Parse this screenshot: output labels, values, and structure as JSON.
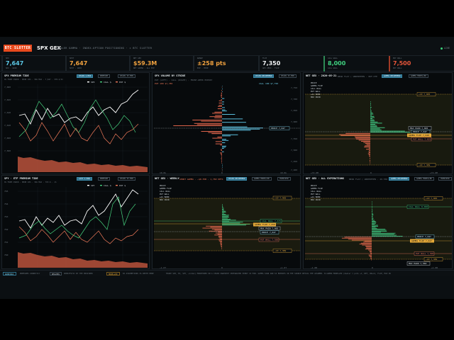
{
  "header": {
    "logo": "BTC SLOTTER",
    "brand": "SPX GEX",
    "subtitle": "DEALER GAMMA · INDEX-OPTION POSITIONING · × BTC SLOTTER",
    "live": "LIVE",
    "live_color": "#39d07a",
    "accent": "#e8491d"
  },
  "stats": [
    {
      "label": "SPX",
      "value": "7,647",
      "caption": "SPX · GRID",
      "color": "#5cc8e6"
    },
    {
      "label": "SPOT",
      "value": "7,647",
      "caption": "SPOT · GRID",
      "color": "#f3a33f"
    },
    {
      "label": "NET GEX",
      "value": "$59.3M",
      "caption": "NET GAMMA · ALL EXP",
      "color": "#f3a33f"
    },
    {
      "label": "RANGE",
      "value": "±258 pts",
      "caption": "EXP · MOVE",
      "color": "#f3a33f"
    },
    {
      "label": "FLIP",
      "value": "7,350",
      "caption": "GEX ZERO · FLIP",
      "color": "#f1f3f4"
    },
    {
      "label": "CALL WALL",
      "value": "8,000",
      "caption": "CALL WALL",
      "color": "#3fd07f"
    },
    {
      "label": "PUT WALL",
      "value": "7,500",
      "caption": "PUT WALL",
      "color": "#e8563a"
    }
  ],
  "panels": {
    "spx_prem": {
      "title": "SPX PREMIUM TIDE",
      "meta": "0% FROM CHAIN · PROB 18% · 30m MLR · 7,647 · 378.4/1h",
      "chips": [
        "CHAIN 1-MIN",
        "PREMIUM",
        "CHAIN 15-MIN"
      ],
      "legend": [
        "SPX",
        "CALL $",
        "PUT $"
      ],
      "y_ticks": [
        "7,680",
        "7,660",
        "7,640",
        "7,620",
        "7,600",
        "7,580"
      ],
      "x_ticks": [
        "09:30",
        "10:30",
        "11:30",
        "12:30",
        "13:30",
        "14:30",
        "15:30"
      ]
    },
    "etf_prem": {
      "title": "SPY · ETF PREMIUM TIDE",
      "meta": "0% FROM CHAIN · PROB 18% · 30m MLR · 763.6 · 1h",
      "chips": [
        "LAST 1-MIN",
        "PREMIUM",
        "CHAIN 15-MIN"
      ],
      "legend": [
        "SPY",
        "CALL $",
        "PUT $"
      ],
      "y_ticks": [
        "765",
        "764",
        "763",
        "762",
        "761",
        "760"
      ],
      "x_ticks": [
        "09:30",
        "10:30",
        "11:30",
        "12:30",
        "13:30",
        "14:30",
        "15:30"
      ]
    },
    "vol_strike": {
      "title": "SPX VOLUME BY STRIKE",
      "meta": "PUT (LEFT) · CALL (RIGHT) · FRONT-WEEK EXPIRY",
      "chips": [
        "CHAIN RECOMMEND",
        "CHAIN 15-MIN"
      ],
      "put_label": "PUT 100 $7,785",
      "call_label": "CALL 100 $7,750",
      "price_label": "PRICE 7,647",
      "y_ticks": [
        "7,750",
        "7,700",
        "7,650",
        "7,600",
        "7,550",
        "7,500",
        "7,450",
        "7,400"
      ],
      "x_ticks": [
        "10.0k",
        "0",
        "10.0k"
      ]
    },
    "gex_0dte": {
      "title": "NET GEX · 2026-05-21",
      "meta": "NEAR FLAT ( UNDERTHEN · 0DF-DTE",
      "chips": [
        "GAMMA RECOMMEND",
        "GAMMA MODELLED"
      ],
      "legend": [
        "PRICE",
        "GAMMA FLIP",
        "CALL WALL",
        "PUT WALL",
        "±1σ BAND",
        "MAX PAIN"
      ],
      "labels": [
        "+1σ 7,905",
        "MAX PAIN 7,665",
        "PRICE 7,647",
        "GAMMA FLIP 7,640",
        "PUT WALL 7,625",
        "−1σ 7,389"
      ],
      "x_ticks": [
        "+72.0M",
        "0",
        "+72.0M"
      ]
    },
    "gex_week": {
      "title": "NET GEX · WEEKLY",
      "meta": "SHORT GAMMA · −$0.35B · 1,760 OPTS",
      "chips": [
        "CHAIN RECOMMEND",
        "GAMMA MODELLED",
        "OVERVIEW"
      ],
      "legend": [
        "PRICE",
        "GAMMA FLIP",
        "CALL WALL",
        "PUT WALL",
        "±1σ BAND",
        "MAX PAIN"
      ],
      "labels": [
        "+1σ 7,905",
        "CALL WALL 7,675",
        "GAMMA FLIP 7,650",
        "MAX PAIN 7,665",
        "PRICE 7,647",
        "PUT WALL 7,500",
        "−1σ 7,389"
      ],
      "x_ticks": [
        "−1.0T",
        "0",
        "+1.0T"
      ]
    },
    "gex_all": {
      "title": "NET GEX · ALL EXPIRATIONS",
      "meta": "NEAR FLAT ( UNDERTHEN · 20.550 OPTS",
      "chips": [
        "GAMMA RECOMMEND",
        "GAMMA MODELLED",
        "OVERVIEW"
      ],
      "legend": [
        "PRICE",
        "GAMMA FLIP",
        "CALL WALL",
        "PUT WALL",
        "±1σ BAND",
        "MAX PAIN"
      ],
      "labels": [
        "+1σ 7,905",
        "CALL WALL 8,000",
        "PRICE 7,647",
        "GAMMA FLIP 7,647",
        "PUT WALL 7,500",
        "−1σ 7,389",
        "MAX PAIN 7,550"
      ],
      "x_ticks": [
        "−1.0B",
        "0",
        "+1.0B"
      ]
    }
  },
  "footer": {
    "tags": [
      "WARNINGS",
      "DEALERS",
      "MODELLED"
    ],
    "texts": [
      "PREMIUMS CORRECTLY",
      "SHERIFSTIC BY THE PROVIDER",
      "6X ASSUMPTIONS IS DEPTH HERE"
    ],
    "note": "TRADE SPX, ES, SPY, +index) MONITORED ON A CHAIN SNAPSHOT INTEGRATED EVERY 15 MIN. GAMMA SIGN AND SI ENTRIES IN THE SOURCE DETAIL THE ASSUMED. B-GAMMA MODELLED (dealer = puts +1, RET, WALLS, FLIP, MAX PA"
  }
}
